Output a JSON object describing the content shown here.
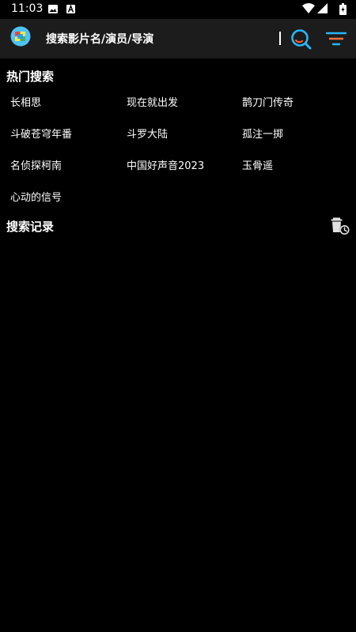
{
  "status_bar": {
    "time": "11:03",
    "icons": [
      "image-notification-icon",
      "a-notification-icon",
      "wifi-icon",
      "signal-icon",
      "battery-icon"
    ]
  },
  "app_bar": {
    "search_placeholder": "搜索影片名/演员/导演",
    "icons": [
      "app-logo-icon",
      "search-icon",
      "filter-icon"
    ],
    "colors": {
      "background": "#1c1c1c",
      "search_icon": "#29b6f6",
      "search_icon_accent": "#ff5722",
      "filter_icon": "#29b6f6",
      "filter_icon_accent": "#ff7043"
    }
  },
  "hot_search": {
    "title": "热门搜索",
    "items": [
      "长相思",
      "现在就出发",
      "鹊刀门传奇",
      "斗破苍穹年番",
      "斗罗大陆",
      "孤注一掷",
      "名侦探柯南",
      "中国好声音2023",
      "玉骨遥",
      "心动的信号"
    ]
  },
  "search_history": {
    "title": "搜索记录",
    "clear_icon": "trash-clock-icon"
  }
}
